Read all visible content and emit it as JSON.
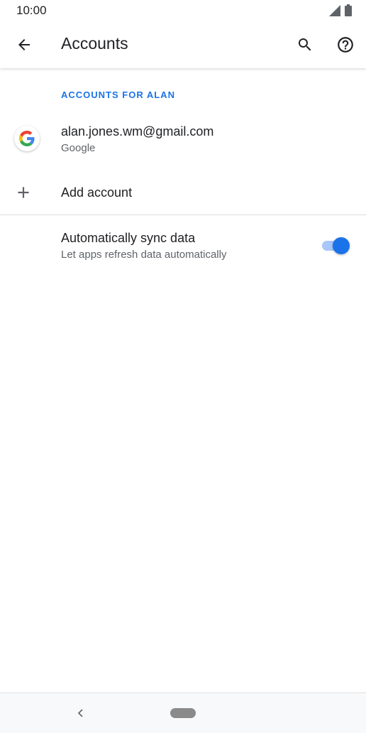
{
  "status_bar": {
    "time": "10:00"
  },
  "app_bar": {
    "title": "Accounts",
    "back_icon": "arrow-back-icon",
    "search_icon": "search-icon",
    "help_icon": "help-icon"
  },
  "accounts_section": {
    "header": "ACCOUNTS FOR ALAN",
    "accounts": [
      {
        "email": "alan.jones.wm@gmail.com",
        "type": "Google",
        "icon": "google-icon"
      }
    ],
    "add_account_label": "Add account"
  },
  "sync": {
    "title": "Automatically sync data",
    "summary": "Let apps refresh data automatically",
    "enabled": true
  },
  "colors": {
    "accent": "#1a73e8",
    "toggle_track": "#a8c7fa",
    "text_primary": "#202124",
    "text_secondary": "#5f6368"
  }
}
